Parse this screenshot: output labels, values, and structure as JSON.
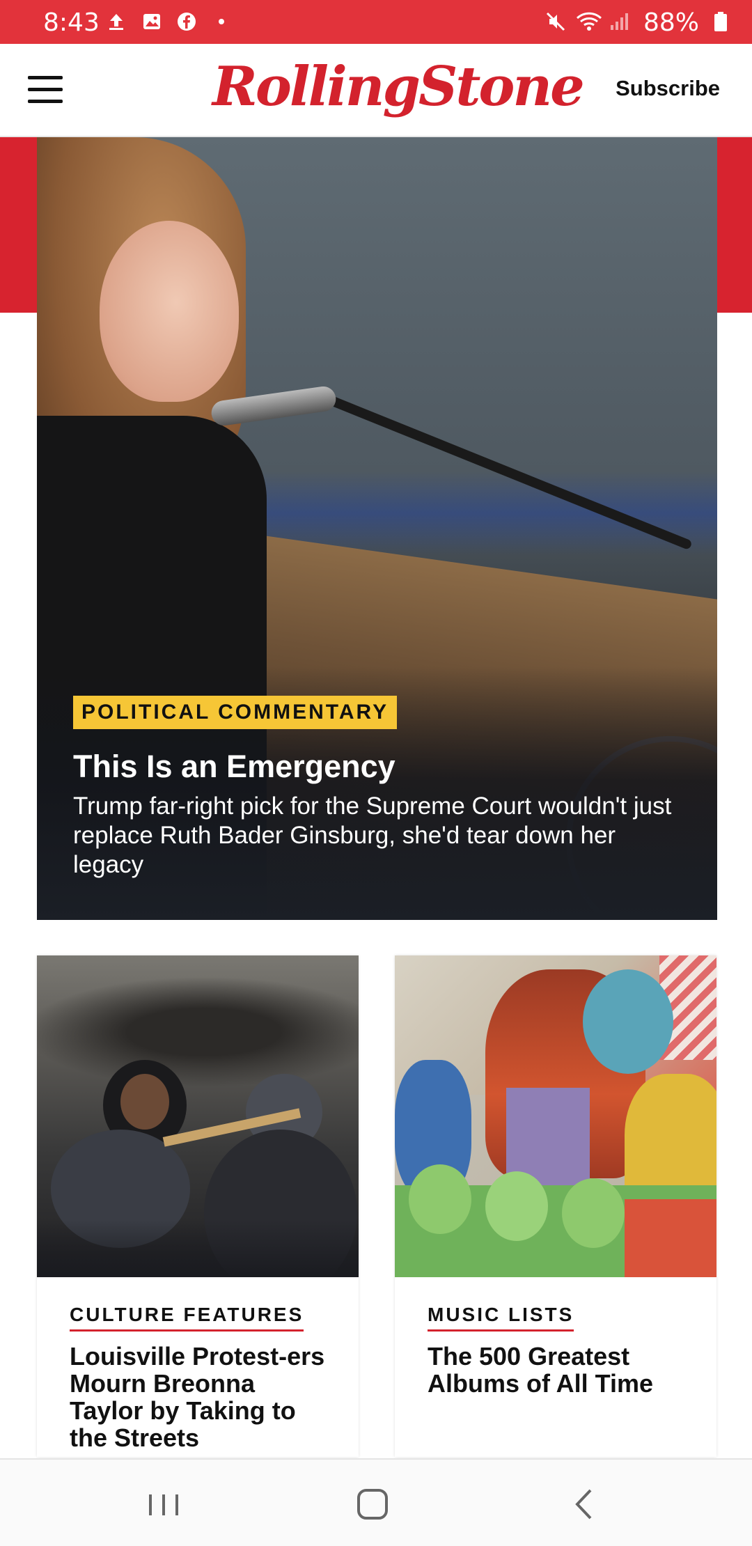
{
  "status_bar": {
    "time": "8:43",
    "battery": "88%",
    "icons": [
      "upload-icon",
      "image-icon",
      "facebook-icon",
      "dot-icon",
      "mute-icon",
      "wifi-icon",
      "signal-icon",
      "battery-icon"
    ],
    "background_color": "#e2333b"
  },
  "header": {
    "logo": "RollingStone",
    "subscribe_label": "Subscribe",
    "logo_color": "#d3222d"
  },
  "hero": {
    "category": "POLITICAL COMMENTARY",
    "headline": "This Is an Emergency",
    "dek": "Trump far-right pick for the Supreme Court wouldn't just replace Ruth Bader Ginsburg, she'd tear down her legacy",
    "category_color": "#f6c636"
  },
  "stories": [
    {
      "category": "CULTURE FEATURES",
      "title": "Louisville Protest-ers Mourn Breonna Taylor by Taking to the Streets"
    },
    {
      "category": "MUSIC LISTS",
      "title": "The 500 Greatest Albums of All Time"
    }
  ],
  "nav_bar": {
    "buttons": [
      "recent-apps-icon",
      "home-icon",
      "back-icon"
    ]
  }
}
